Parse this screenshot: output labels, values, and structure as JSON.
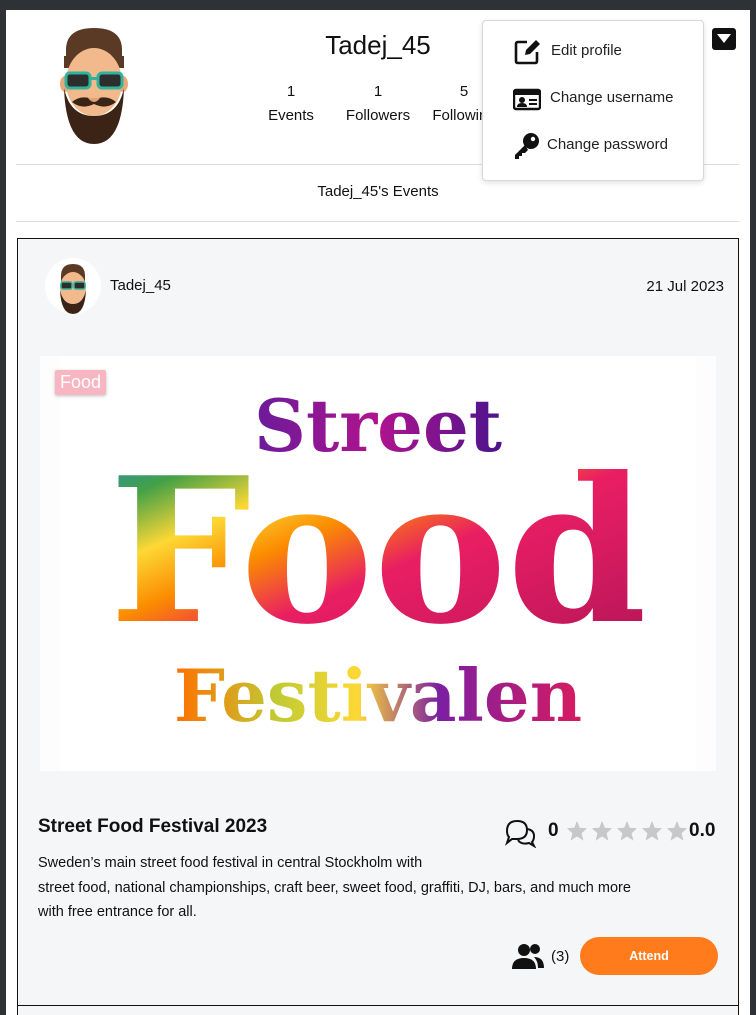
{
  "profile": {
    "username": "Tadej_45",
    "stats": [
      {
        "count": "1",
        "label": "Events"
      },
      {
        "count": "1",
        "label": "Followers"
      },
      {
        "count": "5",
        "label": "Following"
      }
    ],
    "events_heading": "Tadej_45's Events"
  },
  "menu": {
    "items": [
      {
        "label": "Edit profile",
        "icon": "edit-icon"
      },
      {
        "label": "Change username",
        "icon": "id-card-icon"
      },
      {
        "label": "Change password",
        "icon": "key-icon"
      }
    ]
  },
  "event": {
    "author": "Tadej_45",
    "date": "21 Jul 2023",
    "category": "Food",
    "image_text": {
      "line1": "Street",
      "line2": "Food",
      "line3": "Festivalen"
    },
    "title": "Street Food Festival 2023",
    "description_lines": [
      "Sweden’s main street food festival in central Stockholm with",
      "street food, national championships, craft beer, sweet food, graffiti, DJ, bars, and much more",
      "with free entrance for all."
    ],
    "comment_count": "0",
    "rating": "0.0",
    "stars_filled": 0,
    "stars_total": 5,
    "attendee_count": "(3)",
    "attend_label": "Attend"
  },
  "colors": {
    "accent": "#ff7b1c",
    "badge": "#f7b6c2",
    "star_empty": "#c8c8c8"
  }
}
